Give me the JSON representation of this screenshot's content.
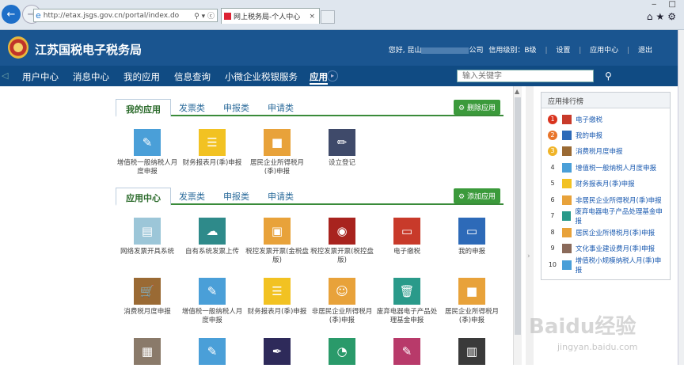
{
  "browser": {
    "url": "http://etax.jsgs.gov.cn/portal/index.do",
    "tab_title": "网上税务局-个人中心"
  },
  "header": {
    "site_title": "江苏国税电子税务局",
    "greeting_prefix": "您好, 昆山",
    "greeting_suffix": "公司",
    "credit": "信用级别：B级",
    "links": [
      "设置",
      "应用中心",
      "退出"
    ]
  },
  "nav": {
    "items": [
      "用户中心",
      "消息中心",
      "我的应用",
      "信息查询",
      "小微企业税银服务",
      "应用"
    ],
    "search_placeholder": "输入关键字"
  },
  "my_apps": {
    "tabs": [
      "我的应用",
      "发票类",
      "申报类",
      "申请类"
    ],
    "button": "删除应用",
    "apps": [
      "增值税一般纳税人月度申报",
      "财务报表月(季)申报",
      "居民企业所得税月(季)申报",
      "设立登记"
    ]
  },
  "app_center": {
    "tabs": [
      "应用中心",
      "发票类",
      "申报类",
      "申请类"
    ],
    "button": "添加应用",
    "row1": [
      "网络发票开具系统",
      "自有系统发票上传",
      "税控发票开票(金税盘版)",
      "税控发票开票(税控盘版)",
      "电子缴税",
      "我的申报"
    ],
    "row2": [
      "消费税月度申报",
      "增值税一般纳税人月度申报",
      "财务报表月(季)申报",
      "非居民企业所得税月(季)申报",
      "废弃电器电子产品处理基金申报",
      "居民企业所得税月(季)申报"
    ]
  },
  "ranking": {
    "title": "应用排行榜",
    "items": [
      {
        "num": "1",
        "label": "电子缴税"
      },
      {
        "num": "2",
        "label": "我的申报"
      },
      {
        "num": "3",
        "label": "消费税月度申报"
      },
      {
        "num": "4",
        "label": "增值税一般纳税人月度申报"
      },
      {
        "num": "5",
        "label": "财务报表月(季)申报"
      },
      {
        "num": "6",
        "label": "非居民企业所得税月(季)申报"
      },
      {
        "num": "7",
        "label": "废弃电器电子产品处理基金申报"
      },
      {
        "num": "8",
        "label": "居民企业所得税月(季)申报"
      },
      {
        "num": "9",
        "label": "文化事业建设费月(季)申报"
      },
      {
        "num": "10",
        "label": "增值税小规模纳税人月(季)申报"
      }
    ]
  },
  "watermark": {
    "text": "Baidu经验",
    "sub": "jingyan.baidu.com"
  }
}
